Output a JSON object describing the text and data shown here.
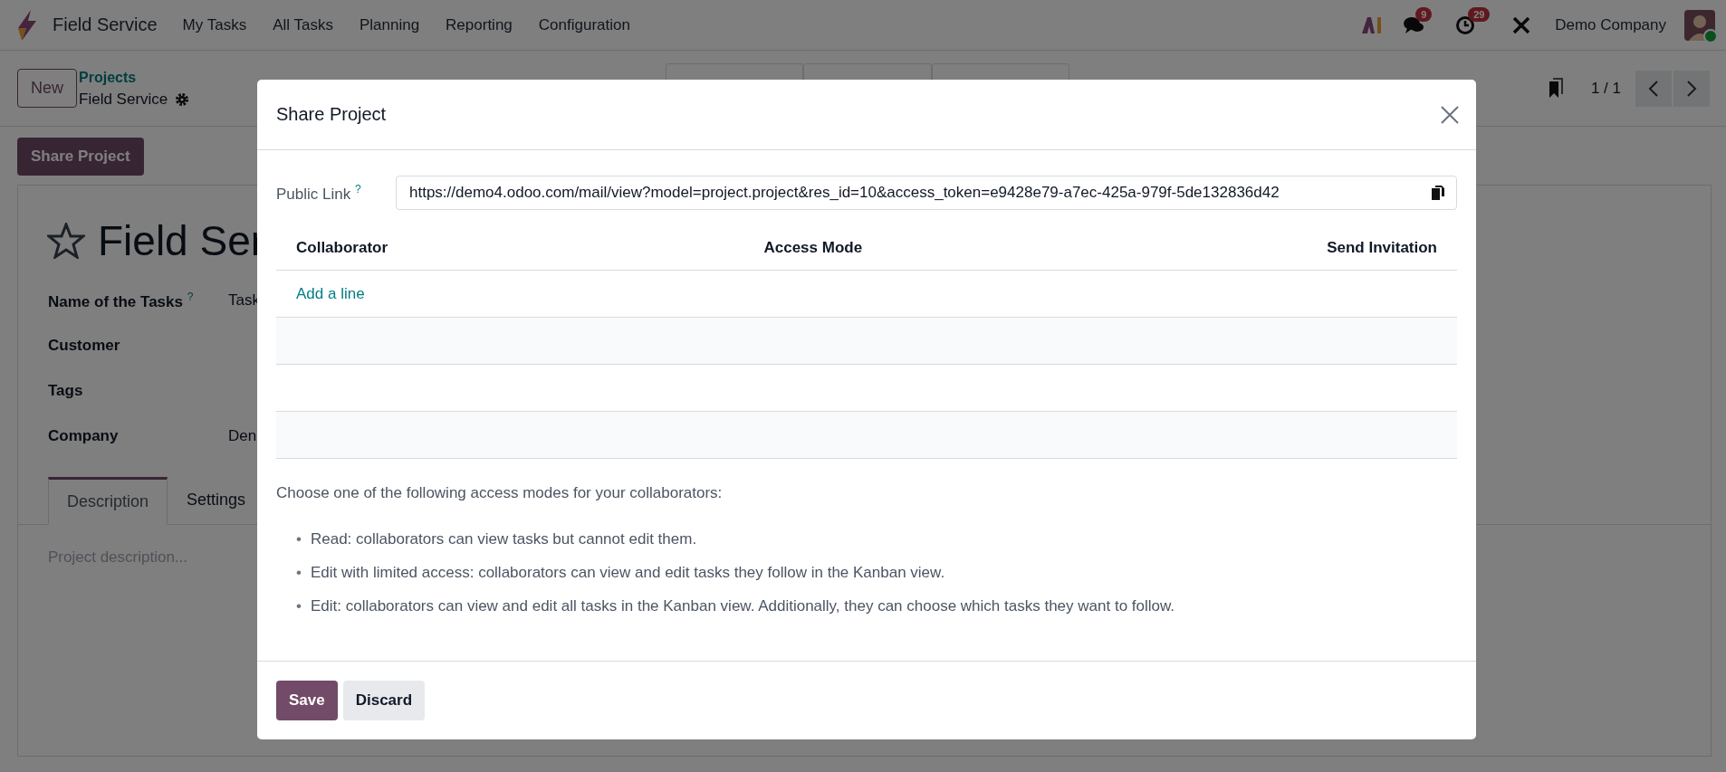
{
  "navbar": {
    "app_name": "Field Service",
    "menu": [
      "My Tasks",
      "All Tasks",
      "Planning",
      "Reporting",
      "Configuration"
    ],
    "messages_count": "9",
    "activities_count": "29",
    "company": "Demo Company"
  },
  "control_panel": {
    "new_button": "New",
    "breadcrumb": "Projects",
    "record_name": "Field Service",
    "pager": "1 / 1"
  },
  "action_button": "Share Project",
  "form": {
    "title": "Field Ser",
    "fields": [
      {
        "label": "Name of the Tasks",
        "help": "?",
        "value": "Task"
      },
      {
        "label": "Customer"
      },
      {
        "label": "Tags"
      },
      {
        "label": "Company",
        "value": "Den"
      }
    ],
    "tabs": [
      {
        "label": "Description",
        "selected": true
      },
      {
        "label": "Settings",
        "selected": false
      }
    ],
    "description": {
      "placeholder": "Project description..."
    }
  },
  "dialog": {
    "title": "Share Project",
    "public_link_label": "Public Link",
    "public_link_help": "?",
    "public_link": "https://demo4.odoo.com/mail/view?model=project.project&res_id=10&access_token=e9428e79-a7ec-425a-979f-5de132836d42",
    "columns": [
      "Collaborator",
      "Access Mode",
      "Send Invitation"
    ],
    "add_line": "Add a line",
    "intro": "Choose one of the following access modes for your collaborators:",
    "access_modes": [
      {
        "bullet": "•",
        "text": "Read: collaborators can view tasks but cannot edit them."
      },
      {
        "bullet": "•",
        "text": "Edit with limited access: collaborators can view and edit tasks they follow in the Kanban view."
      },
      {
        "bullet": "•",
        "text": "Edit: collaborators can view and edit all tasks in the Kanban view. Additionally, they can choose which tasks they want to follow."
      }
    ],
    "buttons": [
      {
        "label": "Save",
        "kind": "primary"
      },
      {
        "label": "Discard",
        "kind": "secondary"
      }
    ]
  }
}
